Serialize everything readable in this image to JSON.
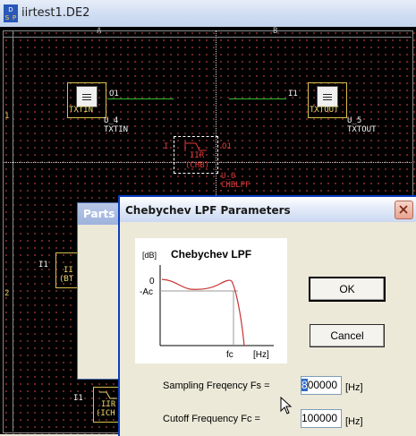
{
  "window": {
    "title": "iirtest1.DE2",
    "app_icon_letters": "DSP"
  },
  "schematic": {
    "col_a": "A",
    "col_b": "B",
    "row_1": "1",
    "row_2": "2",
    "txtin": {
      "label": "TXTIN",
      "port": "O1",
      "name": "U_4",
      "type": "TXTIN"
    },
    "txtout": {
      "label": "TXTOUT",
      "port": "I1",
      "name": "U_5",
      "type": "TXTOUT"
    },
    "cheb": {
      "code": "IIR",
      "tag": "(CHB)",
      "in_port": "I",
      "out_port": "O1",
      "name": "U_0",
      "type": "CHBLPF"
    },
    "partial_bt": {
      "port": "I1",
      "code": "II",
      "tag": "(BT"
    },
    "partial_ich": {
      "port": "I1",
      "code": "IIR",
      "tag": "(ICH"
    }
  },
  "parts_dialog": {
    "title": "Parts"
  },
  "dialog": {
    "title": "Chebychev LPF Parameters",
    "chart": {
      "unit_db": "[dB]",
      "heading": "Chebychev LPF",
      "zero_label": "0",
      "ac_label": "-Ac",
      "fc_label": "fc",
      "hz_label": "[Hz]"
    },
    "ok_label": "OK",
    "cancel_label": "Cancel",
    "fs_label": "Sampling Freqency Fs =",
    "fs_value_sel": "8",
    "fs_value_rest": "00000",
    "fs_unit": "[Hz]",
    "fc_label": "Cutoff Frequency Fc =",
    "fc_value": "100000",
    "fc_unit": "[Hz]"
  }
}
